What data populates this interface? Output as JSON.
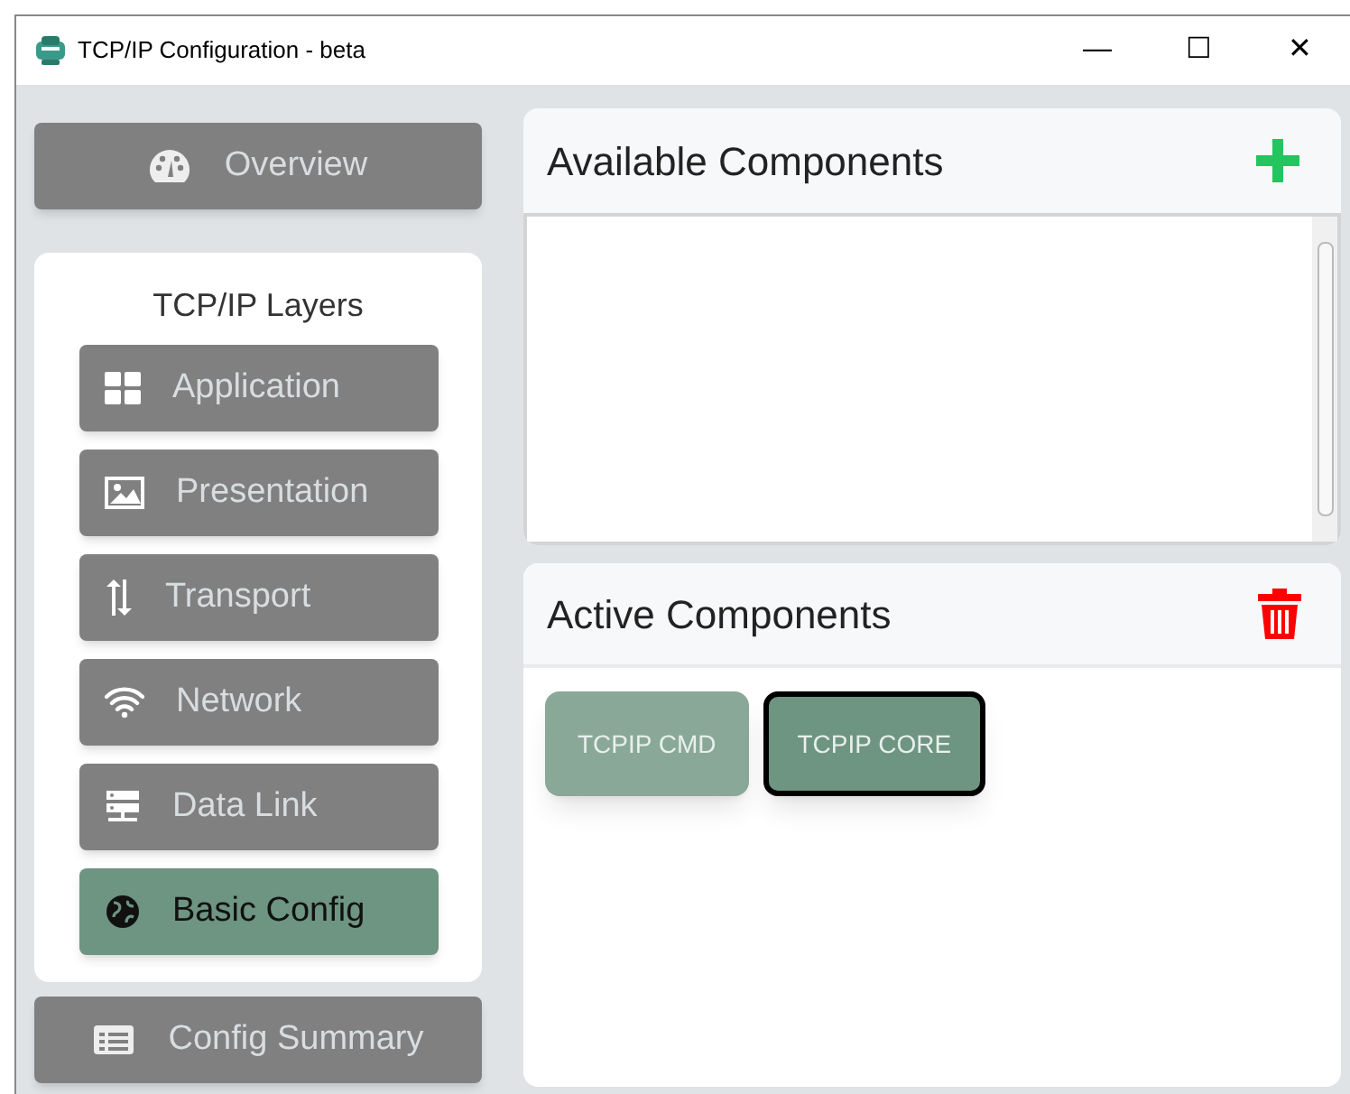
{
  "window": {
    "title": "TCP/IP Configuration - beta",
    "controls": [
      "—",
      "☐",
      "✕"
    ]
  },
  "overview": {
    "label": "Overview",
    "kind": "gauge"
  },
  "layers": {
    "title": "TCP/IP Layers",
    "items": [
      {
        "label": "Application",
        "kind": "grid",
        "selected": false
      },
      {
        "label": "Presentation",
        "kind": "image",
        "selected": false
      },
      {
        "label": "Transport",
        "kind": "arrows",
        "selected": false
      },
      {
        "label": "Network",
        "kind": "wifi",
        "selected": false
      },
      {
        "label": "Data Link",
        "kind": "server",
        "selected": false
      },
      {
        "label": "Basic Config",
        "kind": "globe",
        "selected": true
      }
    ]
  },
  "config_summary": {
    "label": "Config Summary",
    "kind": "list"
  },
  "available": {
    "title": "Available Components"
  },
  "active": {
    "title": "Active Components",
    "components": [
      {
        "label": "TCPIP CMD",
        "selected": false
      },
      {
        "label": "TCPIP CORE",
        "selected": true
      }
    ]
  }
}
